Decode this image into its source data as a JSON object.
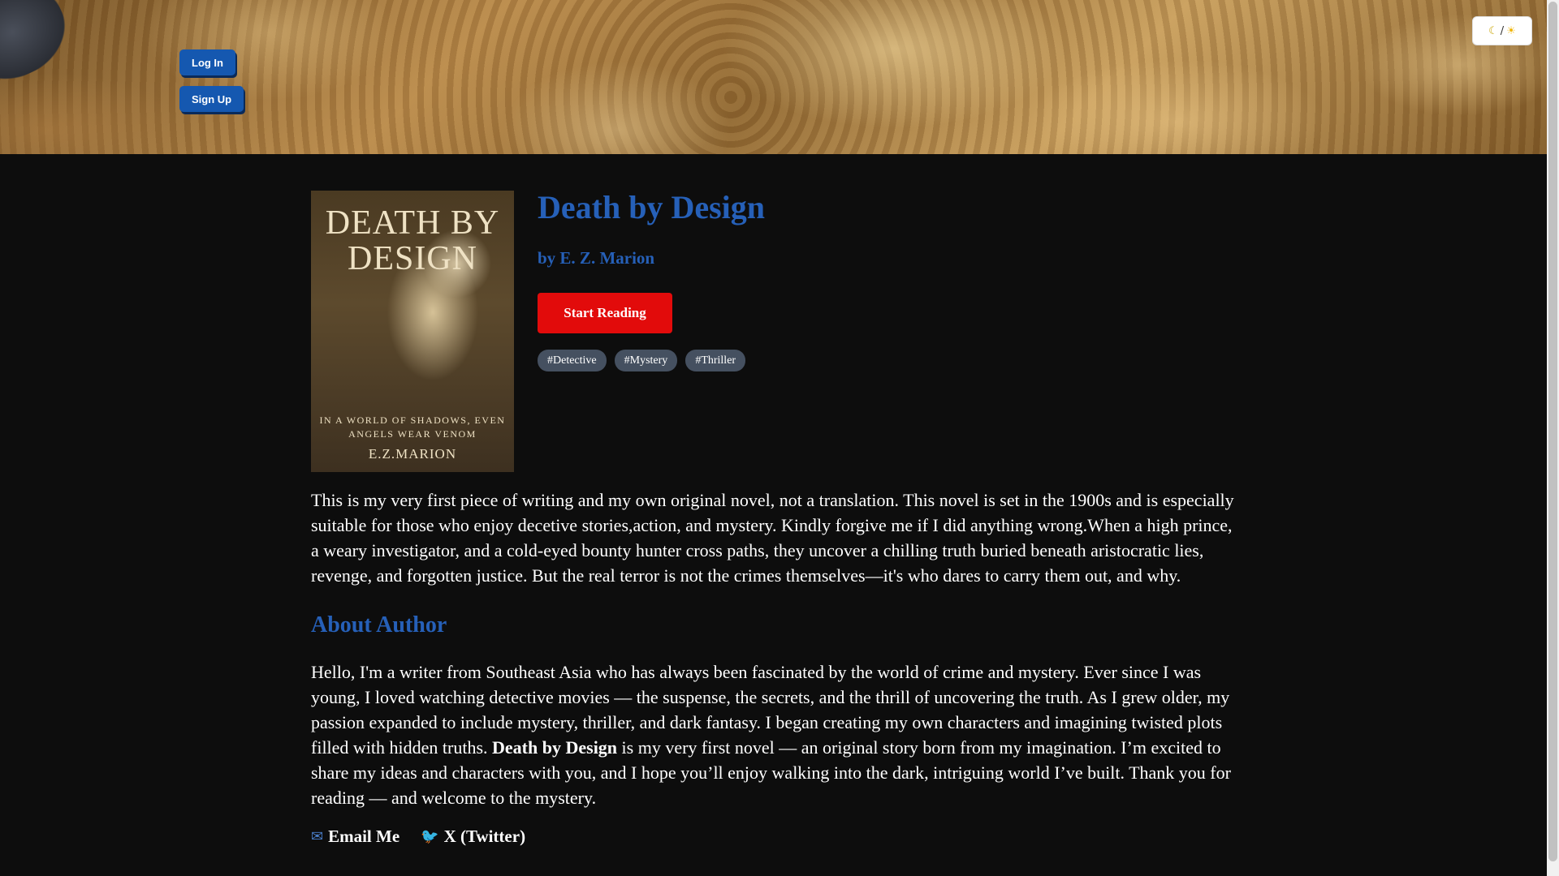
{
  "header": {
    "login_label": "Log In",
    "signup_label": "Sign Up",
    "theme_toggle": {
      "moon_icon": "☾",
      "separator": "/",
      "sun_icon": "☀"
    }
  },
  "book": {
    "cover": {
      "title": "DEATH BY DESIGN",
      "tagline": "IN A WORLD OF SHADOWS, EVEN ANGELS WEAR VENOM",
      "author": "E.Z.MARION"
    },
    "title": "Death by Design",
    "author_line": "by E. Z. Marion",
    "start_label": "Start Reading",
    "tags": [
      "#Detective",
      "#Mystery",
      "#Thriller"
    ],
    "description": "This is my very first piece of writing and my own original novel, not a translation. This novel is set in the 1900s and is especially suitable for those who enjoy decetive stories,action, and mystery. Kindly forgive me if I did anything wrong.When a high prince, a weary investigator, and a cold-eyed bounty hunter cross paths, they uncover a chilling truth buried beneath aristocratic lies, revenge, and forgotten justice. But the real terror is not the crimes themselves—it's who dares to carry them out, and why."
  },
  "about": {
    "heading": "About Author",
    "text_before": "Hello, I'm a writer from Southeast Asia who has always been fascinated by the world of crime and mystery. Ever since I was young, I loved watching detective movies — the suspense, the secrets, and the thrill of uncovering the truth. As I grew older, my passion expanded to include mystery, thriller, and dark fantasy. I began creating my own characters and imagining twisted plots filled with hidden truths. ",
    "text_bold": "Death by Design",
    "text_after": " is my very first novel — an original story born from my imagination. I’m excited to share my ideas and characters with you, and I hope you’ll enjoy walking into the dark, intriguing world I’ve built. Thank you for reading — and welcome to the mystery."
  },
  "contacts": {
    "email_label": "Email Me",
    "email_icon": "email-icon",
    "twitter_label": "X (Twitter)",
    "twitter_icon": "bird-icon"
  }
}
